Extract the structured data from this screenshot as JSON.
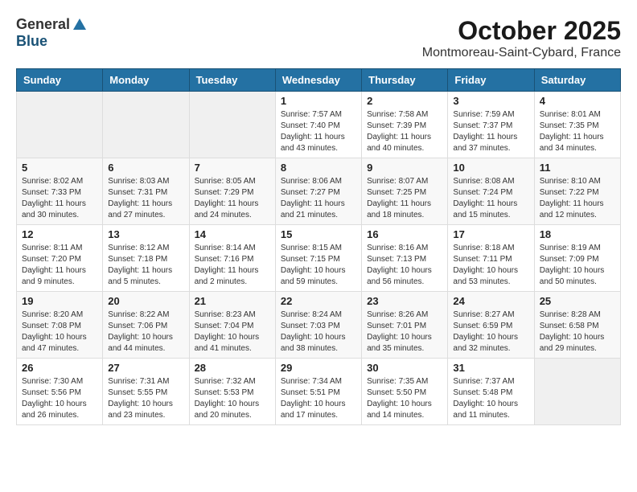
{
  "logo": {
    "general": "General",
    "blue": "Blue"
  },
  "title": "October 2025",
  "location": "Montmoreau-Saint-Cybard, France",
  "days_header": [
    "Sunday",
    "Monday",
    "Tuesday",
    "Wednesday",
    "Thursday",
    "Friday",
    "Saturday"
  ],
  "weeks": [
    [
      {
        "day": "",
        "info": ""
      },
      {
        "day": "",
        "info": ""
      },
      {
        "day": "",
        "info": ""
      },
      {
        "day": "1",
        "info": "Sunrise: 7:57 AM\nSunset: 7:40 PM\nDaylight: 11 hours\nand 43 minutes."
      },
      {
        "day": "2",
        "info": "Sunrise: 7:58 AM\nSunset: 7:39 PM\nDaylight: 11 hours\nand 40 minutes."
      },
      {
        "day": "3",
        "info": "Sunrise: 7:59 AM\nSunset: 7:37 PM\nDaylight: 11 hours\nand 37 minutes."
      },
      {
        "day": "4",
        "info": "Sunrise: 8:01 AM\nSunset: 7:35 PM\nDaylight: 11 hours\nand 34 minutes."
      }
    ],
    [
      {
        "day": "5",
        "info": "Sunrise: 8:02 AM\nSunset: 7:33 PM\nDaylight: 11 hours\nand 30 minutes."
      },
      {
        "day": "6",
        "info": "Sunrise: 8:03 AM\nSunset: 7:31 PM\nDaylight: 11 hours\nand 27 minutes."
      },
      {
        "day": "7",
        "info": "Sunrise: 8:05 AM\nSunset: 7:29 PM\nDaylight: 11 hours\nand 24 minutes."
      },
      {
        "day": "8",
        "info": "Sunrise: 8:06 AM\nSunset: 7:27 PM\nDaylight: 11 hours\nand 21 minutes."
      },
      {
        "day": "9",
        "info": "Sunrise: 8:07 AM\nSunset: 7:25 PM\nDaylight: 11 hours\nand 18 minutes."
      },
      {
        "day": "10",
        "info": "Sunrise: 8:08 AM\nSunset: 7:24 PM\nDaylight: 11 hours\nand 15 minutes."
      },
      {
        "day": "11",
        "info": "Sunrise: 8:10 AM\nSunset: 7:22 PM\nDaylight: 11 hours\nand 12 minutes."
      }
    ],
    [
      {
        "day": "12",
        "info": "Sunrise: 8:11 AM\nSunset: 7:20 PM\nDaylight: 11 hours\nand 9 minutes."
      },
      {
        "day": "13",
        "info": "Sunrise: 8:12 AM\nSunset: 7:18 PM\nDaylight: 11 hours\nand 5 minutes."
      },
      {
        "day": "14",
        "info": "Sunrise: 8:14 AM\nSunset: 7:16 PM\nDaylight: 11 hours\nand 2 minutes."
      },
      {
        "day": "15",
        "info": "Sunrise: 8:15 AM\nSunset: 7:15 PM\nDaylight: 10 hours\nand 59 minutes."
      },
      {
        "day": "16",
        "info": "Sunrise: 8:16 AM\nSunset: 7:13 PM\nDaylight: 10 hours\nand 56 minutes."
      },
      {
        "day": "17",
        "info": "Sunrise: 8:18 AM\nSunset: 7:11 PM\nDaylight: 10 hours\nand 53 minutes."
      },
      {
        "day": "18",
        "info": "Sunrise: 8:19 AM\nSunset: 7:09 PM\nDaylight: 10 hours\nand 50 minutes."
      }
    ],
    [
      {
        "day": "19",
        "info": "Sunrise: 8:20 AM\nSunset: 7:08 PM\nDaylight: 10 hours\nand 47 minutes."
      },
      {
        "day": "20",
        "info": "Sunrise: 8:22 AM\nSunset: 7:06 PM\nDaylight: 10 hours\nand 44 minutes."
      },
      {
        "day": "21",
        "info": "Sunrise: 8:23 AM\nSunset: 7:04 PM\nDaylight: 10 hours\nand 41 minutes."
      },
      {
        "day": "22",
        "info": "Sunrise: 8:24 AM\nSunset: 7:03 PM\nDaylight: 10 hours\nand 38 minutes."
      },
      {
        "day": "23",
        "info": "Sunrise: 8:26 AM\nSunset: 7:01 PM\nDaylight: 10 hours\nand 35 minutes."
      },
      {
        "day": "24",
        "info": "Sunrise: 8:27 AM\nSunset: 6:59 PM\nDaylight: 10 hours\nand 32 minutes."
      },
      {
        "day": "25",
        "info": "Sunrise: 8:28 AM\nSunset: 6:58 PM\nDaylight: 10 hours\nand 29 minutes."
      }
    ],
    [
      {
        "day": "26",
        "info": "Sunrise: 7:30 AM\nSunset: 5:56 PM\nDaylight: 10 hours\nand 26 minutes."
      },
      {
        "day": "27",
        "info": "Sunrise: 7:31 AM\nSunset: 5:55 PM\nDaylight: 10 hours\nand 23 minutes."
      },
      {
        "day": "28",
        "info": "Sunrise: 7:32 AM\nSunset: 5:53 PM\nDaylight: 10 hours\nand 20 minutes."
      },
      {
        "day": "29",
        "info": "Sunrise: 7:34 AM\nSunset: 5:51 PM\nDaylight: 10 hours\nand 17 minutes."
      },
      {
        "day": "30",
        "info": "Sunrise: 7:35 AM\nSunset: 5:50 PM\nDaylight: 10 hours\nand 14 minutes."
      },
      {
        "day": "31",
        "info": "Sunrise: 7:37 AM\nSunset: 5:48 PM\nDaylight: 10 hours\nand 11 minutes."
      },
      {
        "day": "",
        "info": ""
      }
    ]
  ]
}
